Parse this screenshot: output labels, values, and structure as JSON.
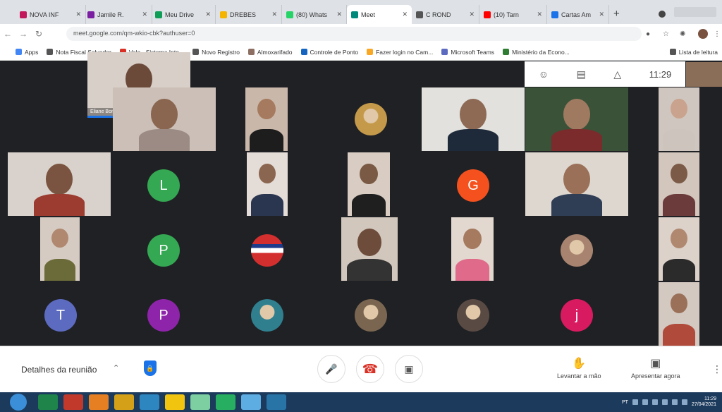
{
  "browser": {
    "tabs": [
      {
        "label": "NOVA INF",
        "color": "#c2185b"
      },
      {
        "label": "Jamile R.",
        "color": "#7b1fa2"
      },
      {
        "label": "Meu Drive",
        "color": "#0f9d58"
      },
      {
        "label": "DREBES",
        "color": "#f4b400"
      },
      {
        "label": "(80) Whats",
        "color": "#25d366"
      },
      {
        "label": "Meet",
        "color": "#00897b"
      },
      {
        "label": "C ROND",
        "color": "#555555"
      },
      {
        "label": "(10) Tarn",
        "color": "#ff0000"
      },
      {
        "label": "Cartas Am",
        "color": "#1a73e8"
      }
    ],
    "new_tab": "+",
    "url": "meet.google.com/qm-wkio-cbk?authuser=0",
    "bookmarks": [
      {
        "label": "Apps",
        "color": "#4285f4"
      },
      {
        "label": "Nota Fiscal Salvador",
        "color": "#555555"
      },
      {
        "label": "Vale · Sistema Inte...",
        "color": "#d93025"
      },
      {
        "label": "Novo Registro",
        "color": "#555555"
      },
      {
        "label": "Almoxarifado",
        "color": "#8d6e63"
      },
      {
        "label": "Controle de Ponto",
        "color": "#1565c0"
      },
      {
        "label": "Fazer login no Cam...",
        "color": "#f9a825"
      },
      {
        "label": "Microsoft Teams",
        "color": "#5c6bc0"
      },
      {
        "label": "Ministério da Econo...",
        "color": "#2e7d32"
      },
      {
        "label": "Lista de leitura",
        "color": "#555555"
      }
    ]
  },
  "meet": {
    "time": "11:29",
    "top_icons": [
      "people-icon",
      "chat-icon",
      "activities-icon"
    ],
    "tiles": [
      {
        "type": "video",
        "name": "Eliane Bomapaz",
        "bg": "#d8cfc9",
        "skin": "#6b4a3a",
        "shirt": "#c44b3b"
      },
      {
        "type": "video",
        "bg": "#cbbfb7",
        "skin": "#8a6650",
        "shirt": "#9b8b84"
      },
      {
        "type": "video",
        "bg": "#c9b7aa",
        "skin": "#a57a5e",
        "shirt": "#1d1d1d"
      },
      {
        "type": "avatar-img",
        "color": "#c49a4a"
      },
      {
        "type": "video",
        "bg": "#e2e1dd",
        "skin": "#8e6a55",
        "shirt": "#1e2a3a"
      },
      {
        "type": "video",
        "bg": "#3a5238",
        "skin": "#a07a60",
        "shirt": "#7b2b2b"
      },
      {
        "type": "video",
        "bg": "#cfc6bf",
        "skin": "#c9a38d",
        "shirt": "#ccc4bd"
      },
      {
        "type": "video",
        "bg": "#d9d2cc",
        "skin": "#7a5440",
        "shirt": "#9c3b30"
      },
      {
        "type": "avatar",
        "letter": "L",
        "color": "#34a853"
      },
      {
        "type": "video",
        "bg": "#e4dcd6",
        "skin": "#8a6650",
        "shirt": "#2a3550"
      },
      {
        "type": "video",
        "bg": "#d9cdc3",
        "skin": "#7a5a45",
        "shirt": "#1f1f1f"
      },
      {
        "type": "avatar",
        "letter": "G",
        "color": "#f4511e"
      },
      {
        "type": "video",
        "bg": "#ded7cf",
        "skin": "#9a7058",
        "shirt": "#2f3d55"
      },
      {
        "type": "video",
        "bg": "#d3c7bd",
        "skin": "#7c5a48",
        "shirt": "#6b3a3a"
      },
      {
        "type": "video",
        "bg": "#d6cbc2",
        "skin": "#b08870",
        "shirt": "#6b6b3a"
      },
      {
        "type": "avatar",
        "letter": "P",
        "color": "#34a853"
      },
      {
        "type": "flag"
      },
      {
        "type": "video",
        "bg": "#d2c7bc",
        "skin": "#6d4c3b",
        "shirt": "#333333"
      },
      {
        "type": "video",
        "bg": "#e2d8cf",
        "skin": "#a57a5e",
        "shirt": "#e06a8a"
      },
      {
        "type": "avatar-img",
        "color": "#a88470"
      },
      {
        "type": "video",
        "bg": "#dcd2ca",
        "skin": "#b08870",
        "shirt": "#2b2b2b"
      },
      {
        "type": "avatar",
        "letter": "T",
        "color": "#5c6bc0"
      },
      {
        "type": "avatar",
        "letter": "P",
        "color": "#8e24aa"
      },
      {
        "type": "avatar-img",
        "color": "#2f7f8f"
      },
      {
        "type": "avatar-img",
        "color": "#7a6650"
      },
      {
        "type": "avatar-img",
        "color": "#5a4a44"
      },
      {
        "type": "avatar",
        "letter": "j",
        "color": "#d81b60"
      },
      {
        "type": "video",
        "bg": "#d3c9c1",
        "skin": "#9a7058",
        "shirt": "#b04a3a"
      }
    ],
    "bottom": {
      "details_label": "Detalhes da reunião",
      "raise_hand_label": "Levantar a mão",
      "present_label": "Apresentar agora"
    }
  },
  "taskbar": {
    "apps": [
      "#1e8449",
      "#c0392b",
      "#e67e22",
      "#d4a017",
      "#2e86c1",
      "#f1c40f",
      "#7dcea0",
      "#27ae60",
      "#5dade2",
      "#2874a6"
    ],
    "clock_time": "11:29",
    "clock_date": "27/04/2021",
    "tray_label": "PT"
  }
}
